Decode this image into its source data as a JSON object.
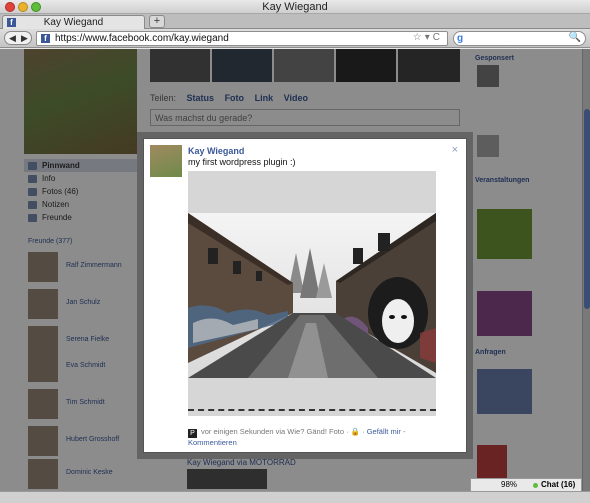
{
  "window": {
    "title": "Kay Wiegand"
  },
  "tabs": [
    {
      "label": "Kay Wiegand",
      "favicon": "f"
    }
  ],
  "newtab": {
    "label": "+"
  },
  "nav": {
    "back": "◀",
    "forward": "▶",
    "url": "https://www.facebook.com/kay.wiegand",
    "url_icons": "☆▾C",
    "search_logo": "g",
    "search_icon": "🔍"
  },
  "page": {
    "share": {
      "label": "Teilen:",
      "status": "Status",
      "foto": "Foto",
      "link": "Link",
      "video": "Video"
    },
    "status_placeholder": "Was machst du gerade?",
    "leftnav": [
      {
        "label": "Pinnwand"
      },
      {
        "label": "Info"
      },
      {
        "label": "Fotos (46)"
      },
      {
        "label": "Notizen"
      },
      {
        "label": "Freunde"
      }
    ],
    "friends_head": "Freunde (377)",
    "friends": [
      {
        "name": "Ralf Zimmermann"
      },
      {
        "name": "Jan Schulz"
      },
      {
        "name": "Serena Fielke"
      },
      {
        "name": "Eva Schmidt"
      },
      {
        "name": "Tim Schmidt"
      },
      {
        "name": "Hubert Grosshoff"
      },
      {
        "name": "Dominic Keske"
      }
    ],
    "right_heads": [
      "Gesponsert",
      "Veranstaltungen",
      "Anfragen"
    ],
    "bottom_post": "Kay Wiegand via MOTORRAD"
  },
  "modal": {
    "author": "Kay Wiegand",
    "message": "my first wordpress plugin :)",
    "close": "×",
    "footer_icon": "P",
    "footer_time": "vor einigen Sekunden via Wie? Gänd! Foto · ",
    "footer_lock": "🔒",
    "footer_sep": " · ",
    "like": "Gefällt mir",
    "comments": "Kommentieren"
  },
  "chat": {
    "battery": "98%",
    "label": "Chat (16)"
  },
  "colors": {
    "facebook_blue": "#3b5998",
    "dim": "rgba(0,0,0,0.45)"
  }
}
